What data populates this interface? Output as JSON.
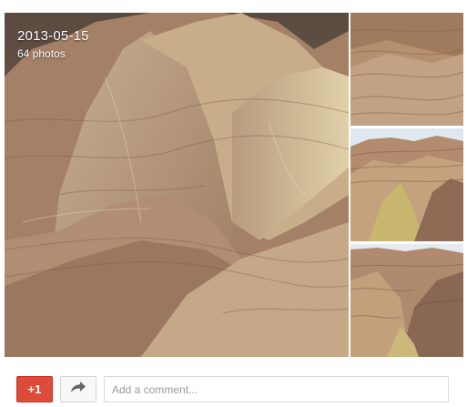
{
  "album": {
    "date": "2013-05-15",
    "photo_count": "64 photos"
  },
  "icons": {
    "share": "share-arrow-icon"
  },
  "actions": {
    "plus_one_label": "+1",
    "comment_placeholder": "Add a comment..."
  },
  "colors": {
    "plus_one": "#dd4b39",
    "share_background": "#f8f8f8",
    "border": "#d9d9d9",
    "placeholder": "#999999"
  }
}
